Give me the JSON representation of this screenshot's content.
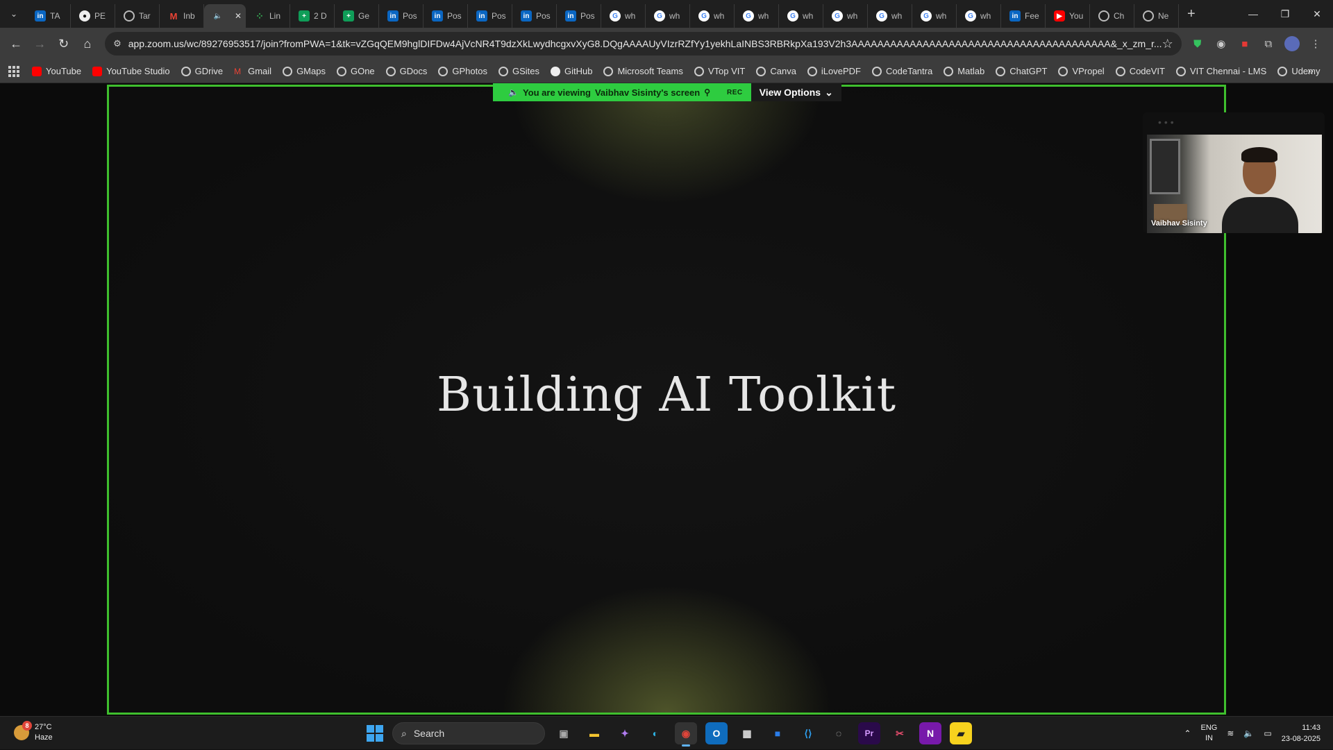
{
  "browser": {
    "tabs": [
      {
        "label": "TA",
        "icon": "linkedin-icon"
      },
      {
        "label": "PE",
        "icon": "github-icon"
      },
      {
        "label": "Tar",
        "icon": "globe-icon"
      },
      {
        "label": "Inb",
        "icon": "gmail-icon"
      },
      {
        "label": "",
        "icon": "speaker-icon",
        "active": true
      },
      {
        "label": "Lin",
        "icon": "dots-icon"
      },
      {
        "label": "2 D",
        "icon": "sheets-icon"
      },
      {
        "label": "Ge",
        "icon": "sheets-icon"
      },
      {
        "label": "Pos",
        "icon": "linkedin-icon"
      },
      {
        "label": "Pos",
        "icon": "linkedin-icon"
      },
      {
        "label": "Pos",
        "icon": "linkedin-icon"
      },
      {
        "label": "Pos",
        "icon": "linkedin-icon"
      },
      {
        "label": "Pos",
        "icon": "linkedin-icon"
      },
      {
        "label": "wh",
        "icon": "google-icon"
      },
      {
        "label": "wh",
        "icon": "google-icon"
      },
      {
        "label": "wh",
        "icon": "google-icon"
      },
      {
        "label": "wh",
        "icon": "google-icon"
      },
      {
        "label": "wh",
        "icon": "google-icon"
      },
      {
        "label": "wh",
        "icon": "google-icon"
      },
      {
        "label": "wh",
        "icon": "google-icon"
      },
      {
        "label": "wh",
        "icon": "google-icon"
      },
      {
        "label": "wh",
        "icon": "google-icon"
      },
      {
        "label": "Fee",
        "icon": "linkedin-icon"
      },
      {
        "label": "You",
        "icon": "youtube-icon"
      },
      {
        "label": "Ch",
        "icon": "chatgpt-icon"
      },
      {
        "label": "Ne",
        "icon": "globe-icon"
      }
    ],
    "url": "app.zoom.us/wc/89276953517/join?fromPWA=1&tk=vZGqQEM9hglDIFDw4AjVcNR4T9dzXkLwydhcgxvXyG8.DQgAAAAUyVIzrRZfYy1yekhLaINBS3RBRkpXa193V2h3AAAAAAAAAAAAAAAAAAAAAAAAAAAAAAAAAAAAAAAA&_x_zm_r...",
    "bookmarks": [
      "YouTube",
      "YouTube Studio",
      "GDrive",
      "Gmail",
      "GMaps",
      "GOne",
      "GDocs",
      "GPhotos",
      "GSites",
      "GitHub",
      "Microsoft Teams",
      "VTop VIT",
      "Canva",
      "iLovePDF",
      "CodeTantra",
      "Matlab",
      "ChatGPT",
      "VPropel",
      "CodeVIT",
      "VIT Chennai - LMS",
      "Udemy"
    ]
  },
  "zoom": {
    "banner_text": "You are viewing",
    "presenter": "Vaibhav Sisinty's screen",
    "rec_label": "REC",
    "view_options": "View Options",
    "slide_title": "Building AI Toolkit",
    "participant_name": "Vaibhav Sisinty",
    "accent_color": "#3fbf2e"
  },
  "taskbar": {
    "temperature": "27°C",
    "weather": "Haze",
    "weather_badge": "8",
    "search_label": "Search",
    "apps": [
      "task-view",
      "file-explorer",
      "copilot",
      "edge",
      "chrome",
      "outlook",
      "store",
      "todo",
      "vscode",
      "obs",
      "premiere-pro",
      "snipping-tool",
      "onenote",
      "sticky-notes"
    ],
    "lang_line1": "ENG",
    "lang_line2": "IN",
    "time": "11:43",
    "date": "23-08-2025"
  }
}
